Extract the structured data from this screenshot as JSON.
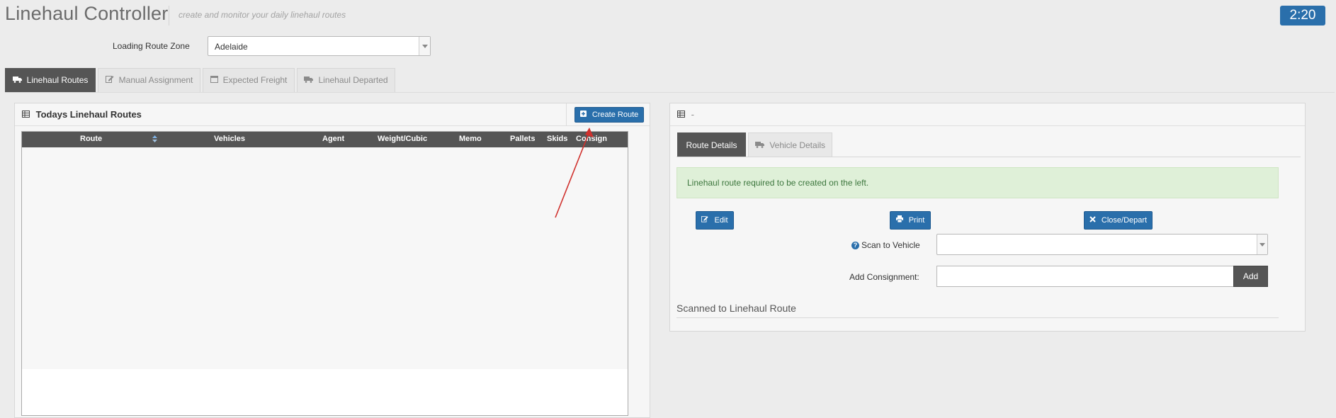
{
  "header": {
    "title": "Linehaul Controller",
    "subtitle": "create and monitor your daily linehaul routes",
    "clock": "2:20"
  },
  "zone": {
    "label": "Loading Route Zone",
    "value": "Adelaide"
  },
  "tabs": [
    {
      "label": "Linehaul Routes",
      "icon": "truck-icon"
    },
    {
      "label": "Manual Assignment",
      "icon": "edit-icon"
    },
    {
      "label": "Expected Freight",
      "icon": "calendar-icon"
    },
    {
      "label": "Linehaul Departed",
      "icon": "truck-icon"
    }
  ],
  "left_panel": {
    "title": "Todays Linehaul Routes",
    "create_button": "Create Route",
    "columns": [
      "Route",
      "Vehicles",
      "Agent",
      "Weight/Cubic",
      "Memo",
      "Pallets",
      "Skids",
      "Consign"
    ]
  },
  "right_panel": {
    "title": "-",
    "tabs": [
      {
        "label": "Route Details"
      },
      {
        "label": "Vehicle Details"
      }
    ],
    "alert": "Linehaul route required to be created on the left.",
    "buttons": {
      "edit": "Edit",
      "print": "Print",
      "close": "Close/Depart"
    },
    "scan_label": "Scan to Vehicle",
    "scan_value": "",
    "consign_label": "Add Consignment:",
    "consign_value": "",
    "add_label": "Add",
    "scanned_title": "Scanned to Linehaul Route"
  },
  "colors": {
    "primary": "#2a6fab",
    "dark": "#555555",
    "alert_bg": "#dff0d8",
    "alert_text": "#3c763d",
    "annotation": "#d0312d"
  }
}
